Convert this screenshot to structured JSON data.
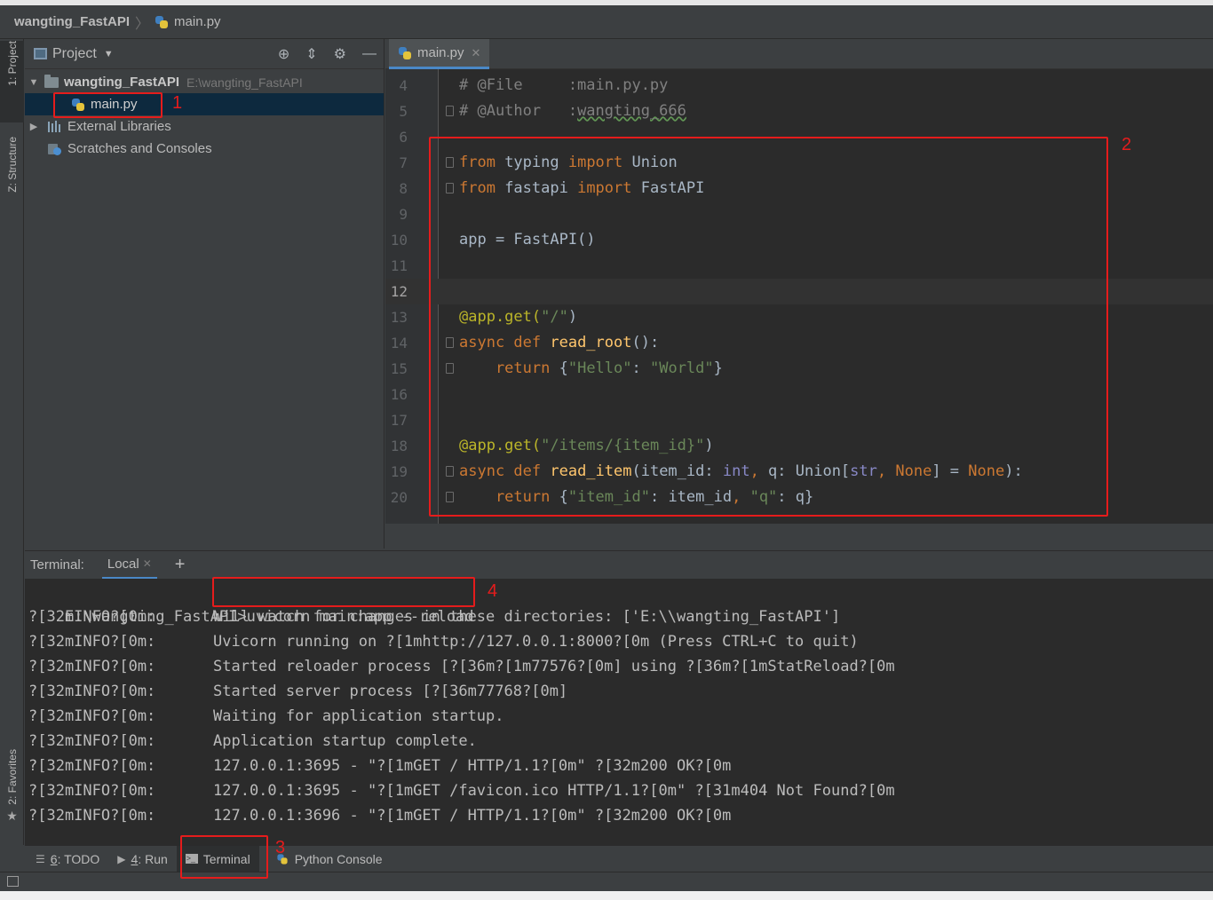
{
  "navbar": {
    "project": "wangting_FastAPI",
    "file": "main.py"
  },
  "tool_strip": {
    "project": "1: Project",
    "structure": "Z: Structure",
    "favorites": "2: Favorites"
  },
  "project_panel": {
    "title": "Project",
    "root": {
      "name": "wangting_FastAPI",
      "path": "E:\\wangting_FastAPI"
    },
    "file": "main.py",
    "external_libraries": "External Libraries",
    "scratches": "Scratches and Consoles"
  },
  "editor": {
    "tab": "main.py",
    "lines": [
      {
        "n": "4",
        "parts": [
          {
            "t": "# @File     :main.py.py",
            "c": "c-cmt"
          }
        ]
      },
      {
        "n": "5",
        "parts": [
          {
            "t": "# @Author   :",
            "c": "c-cmt"
          },
          {
            "t": "wangting_666",
            "c": "c-cmt c-wavy"
          }
        ]
      },
      {
        "n": "6",
        "parts": []
      },
      {
        "n": "7",
        "parts": [
          {
            "t": "from ",
            "c": "c-kw"
          },
          {
            "t": "typing ",
            "c": ""
          },
          {
            "t": "import ",
            "c": "c-kw"
          },
          {
            "t": "Union",
            "c": ""
          }
        ]
      },
      {
        "n": "8",
        "parts": [
          {
            "t": "from ",
            "c": "c-kw"
          },
          {
            "t": "fastapi ",
            "c": ""
          },
          {
            "t": "import ",
            "c": "c-kw"
          },
          {
            "t": "FastAPI",
            "c": ""
          }
        ]
      },
      {
        "n": "9",
        "parts": []
      },
      {
        "n": "10",
        "parts": [
          {
            "t": "app = FastAPI()",
            "c": ""
          }
        ]
      },
      {
        "n": "11",
        "parts": []
      },
      {
        "n": "12",
        "parts": []
      },
      {
        "n": "13",
        "parts": [
          {
            "t": "@app.get(",
            "c": "c-dec"
          },
          {
            "t": "\"/\"",
            "c": "c-str"
          },
          {
            "t": ")",
            "c": ""
          }
        ]
      },
      {
        "n": "14",
        "parts": [
          {
            "t": "async def ",
            "c": "c-kw"
          },
          {
            "t": "read_root",
            "c": "c-fn"
          },
          {
            "t": "():",
            "c": ""
          }
        ]
      },
      {
        "n": "15",
        "parts": [
          {
            "t": "    return ",
            "c": "c-kw"
          },
          {
            "t": "{",
            "c": ""
          },
          {
            "t": "\"Hello\"",
            "c": "c-str"
          },
          {
            "t": ": ",
            "c": ""
          },
          {
            "t": "\"World\"",
            "c": "c-str"
          },
          {
            "t": "}",
            "c": ""
          }
        ]
      },
      {
        "n": "16",
        "parts": []
      },
      {
        "n": "17",
        "parts": []
      },
      {
        "n": "18",
        "parts": [
          {
            "t": "@app.get(",
            "c": "c-dec"
          },
          {
            "t": "\"/items/{item_id}\"",
            "c": "c-str"
          },
          {
            "t": ")",
            "c": ""
          }
        ]
      },
      {
        "n": "19",
        "parts": [
          {
            "t": "async def ",
            "c": "c-kw"
          },
          {
            "t": "read_item",
            "c": "c-fn"
          },
          {
            "t": "(item_id: ",
            "c": ""
          },
          {
            "t": "int",
            "c": "c-bi"
          },
          {
            "t": ", ",
            "c": "c-kw"
          },
          {
            "t": "q: Union[",
            "c": ""
          },
          {
            "t": "str",
            "c": "c-bi"
          },
          {
            "t": ", ",
            "c": "c-kw"
          },
          {
            "t": "None",
            "c": "c-kw"
          },
          {
            "t": "] = ",
            "c": ""
          },
          {
            "t": "None",
            "c": "c-kw"
          },
          {
            "t": "):",
            "c": ""
          }
        ]
      },
      {
        "n": "20",
        "parts": [
          {
            "t": "    return ",
            "c": "c-kw"
          },
          {
            "t": "{",
            "c": ""
          },
          {
            "t": "\"item_id\"",
            "c": "c-str"
          },
          {
            "t": ": item_id",
            "c": ""
          },
          {
            "t": ", ",
            "c": "c-kw"
          },
          {
            "t": "\"q\"",
            "c": "c-str"
          },
          {
            "t": ": q}",
            "c": ""
          }
        ]
      }
    ]
  },
  "terminal": {
    "label": "Terminal:",
    "tab": "Local",
    "add": "+",
    "prompt": "E:\\wangting_FastAPI",
    "command": ">uvicorn main:app --reload",
    "prefix": "?[32mINFO?[0m:",
    "logs": [
      "Will watch for changes in these directories: ['E:\\\\wangting_FastAPI']",
      "Uvicorn running on ?[1mhttp://127.0.0.1:8000?[0m (Press CTRL+C to quit)",
      "Started reloader process [?[36m?[1m77576?[0m] using ?[36m?[1mStatReload?[0m",
      "Started server process [?[36m77768?[0m]",
      "Waiting for application startup.",
      "Application startup complete.",
      "127.0.0.1:3695 - \"?[1mGET / HTTP/1.1?[0m\" ?[32m200 OK?[0m",
      "127.0.0.1:3695 - \"?[1mGET /favicon.ico HTTP/1.1?[0m\" ?[31m404 Not Found?[0m",
      "127.0.0.1:3696 - \"?[1mGET / HTTP/1.1?[0m\" ?[32m200 OK?[0m"
    ]
  },
  "bottom_bar": {
    "todo_num": "6",
    "todo": ": TODO",
    "run_num": "4",
    "run": ": Run",
    "terminal": "Terminal",
    "python_console": "Python Console"
  },
  "annotations": {
    "a1": "1",
    "a2": "2",
    "a3": "3",
    "a4": "4"
  },
  "colors": {
    "annotation": "#e51c1c",
    "selection": "#0d293e",
    "accent": "#4a88c7"
  }
}
